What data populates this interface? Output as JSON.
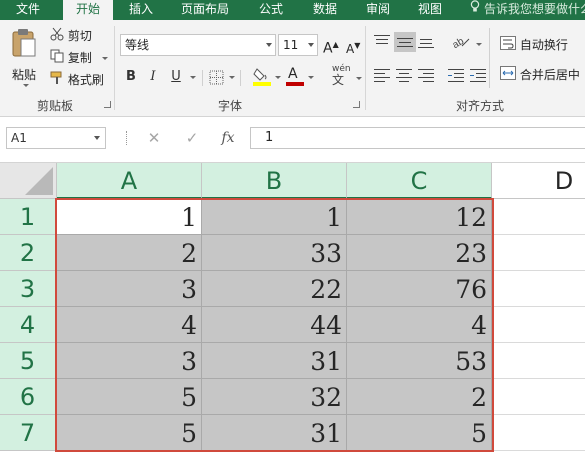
{
  "tabs": [
    {
      "label": "文件",
      "active": false
    },
    {
      "label": "开始",
      "active": true
    },
    {
      "label": "插入",
      "active": false
    },
    {
      "label": "页面布局",
      "active": false
    },
    {
      "label": "公式",
      "active": false
    },
    {
      "label": "数据",
      "active": false
    },
    {
      "label": "审阅",
      "active": false
    },
    {
      "label": "视图",
      "active": false
    }
  ],
  "tell_me": "告诉我您想要做什么",
  "clipboard": {
    "paste": "粘贴",
    "cut": "剪切",
    "copy": "复制",
    "format_painter": "格式刷",
    "group_label": "剪贴板"
  },
  "font": {
    "name": "等线",
    "size": "11",
    "bold": "B",
    "italic": "I",
    "underline": "U",
    "grow": "A",
    "shrink": "A",
    "font_color_glyph": "A",
    "phonetic": "wén",
    "group_label": "字体",
    "fill_color": "#ffff00",
    "font_color": "#c00000"
  },
  "alignment": {
    "wrap_text": "自动换行",
    "merge_center": "合并后居中",
    "group_label": "对齐方式"
  },
  "formula_bar": {
    "name_box": "A1",
    "cancel": "✕",
    "enter": "✓",
    "fx": "fx",
    "value": "1"
  },
  "sheet": {
    "columns": [
      "A",
      "B",
      "C",
      "D"
    ],
    "rows": [
      {
        "num": "1",
        "cells": [
          "1",
          "1",
          "12"
        ]
      },
      {
        "num": "2",
        "cells": [
          "2",
          "33",
          "23"
        ]
      },
      {
        "num": "3",
        "cells": [
          "3",
          "22",
          "76"
        ]
      },
      {
        "num": "4",
        "cells": [
          "4",
          "44",
          "4"
        ]
      },
      {
        "num": "5",
        "cells": [
          "3",
          "31",
          "53"
        ]
      },
      {
        "num": "6",
        "cells": [
          "5",
          "32",
          "2"
        ]
      },
      {
        "num": "7",
        "cells": [
          "5",
          "31",
          "5"
        ]
      }
    ],
    "active_cell": "A1",
    "selection": "A1:C7",
    "selection_border_color": "#d04a3c",
    "header_highlight_color": "#217346"
  }
}
